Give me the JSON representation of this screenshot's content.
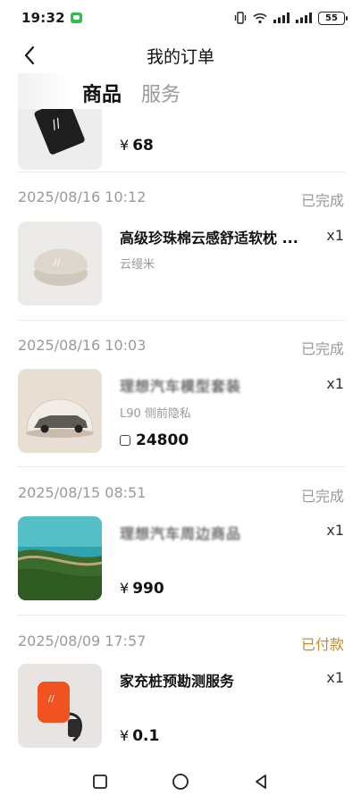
{
  "status_bar": {
    "time": "19:32",
    "battery": "55"
  },
  "header": {
    "title": "我的订单"
  },
  "tabs": [
    {
      "label": "商品",
      "active": true
    },
    {
      "label": "服务",
      "active": false
    }
  ],
  "orders": [
    {
      "date": "",
      "status": "",
      "product": {
        "name": "",
        "sub": "",
        "qty": "",
        "price": "68",
        "currency": "¥"
      }
    },
    {
      "date": "2025/08/16 10:12",
      "status": "已完成",
      "product": {
        "name": "高级珍珠棉云感舒适软枕 ...",
        "sub": "云缦米",
        "qty": "x1",
        "price": "",
        "currency": ""
      }
    },
    {
      "date": "2025/08/16 10:03",
      "status": "已完成",
      "product": {
        "name": "理想汽车模型套装",
        "sub": "L90 侧前隐私",
        "qty": "x1",
        "price": "24800",
        "currency": "coin"
      }
    },
    {
      "date": "2025/08/15 08:51",
      "status": "已完成",
      "product": {
        "name": "理想汽车周边商品",
        "sub": "",
        "qty": "x1",
        "price": "990",
        "currency": "¥"
      }
    },
    {
      "date": "2025/08/09 17:57",
      "status": "已付款",
      "product": {
        "name": "家充桩预勘测服务",
        "sub": "",
        "qty": "x1",
        "price": "0.1",
        "currency": "¥"
      }
    }
  ],
  "colors": {
    "paid_status": "#c98a2b",
    "muted": "#9a9a9a",
    "wechat_green": "#2fbf4e"
  }
}
